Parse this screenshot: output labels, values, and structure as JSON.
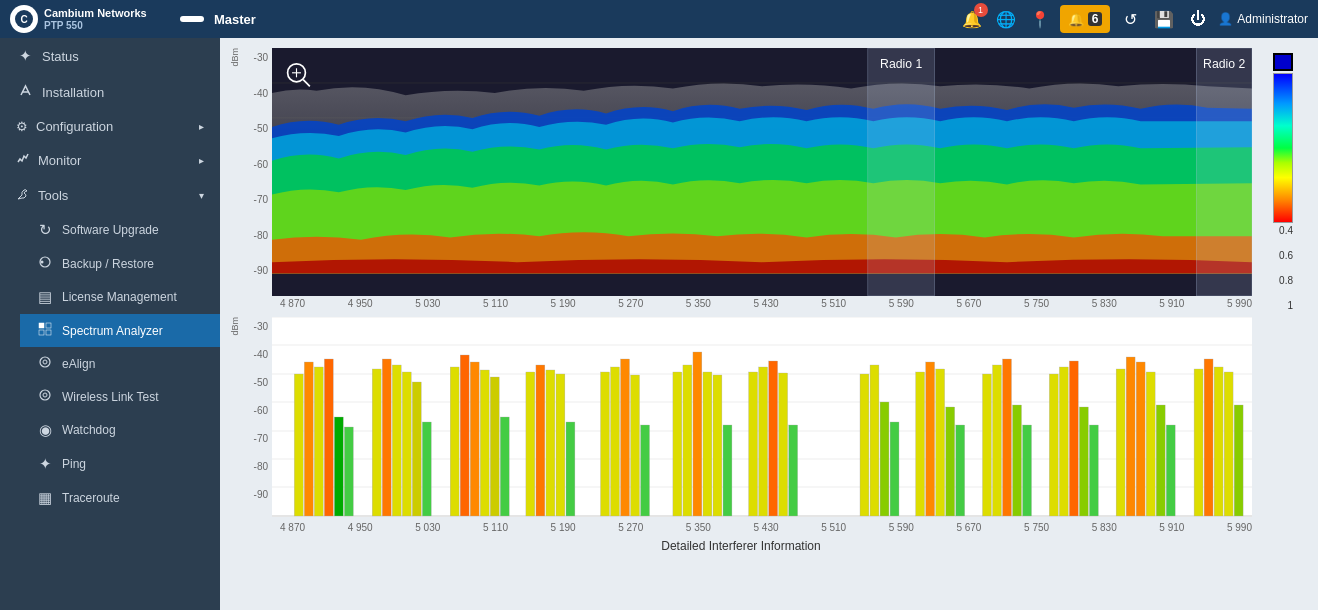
{
  "header": {
    "brand": "Cambium Networks",
    "model": "PTP 550",
    "device_name": "",
    "role": "Master",
    "alarm_label": "Alarms",
    "alarm_count": "6",
    "notification_count": "1",
    "user": "Administrator"
  },
  "sidebar": {
    "items": [
      {
        "id": "status",
        "label": "Status",
        "icon": "✦",
        "active": false
      },
      {
        "id": "installation",
        "label": "Installation",
        "icon": "⚙",
        "active": false
      },
      {
        "id": "configuration",
        "label": "Configuration",
        "icon": "⚙",
        "active": false,
        "has_arrow": true
      },
      {
        "id": "monitor",
        "label": "Monitor",
        "icon": "📊",
        "active": false,
        "has_arrow": true
      },
      {
        "id": "tools",
        "label": "Tools",
        "icon": "🔧",
        "active": false,
        "has_arrow": true
      },
      {
        "id": "software-upgrade",
        "label": "Software Upgrade",
        "icon": "↻",
        "active": false,
        "sub": true
      },
      {
        "id": "backup-restore",
        "label": "Backup / Restore",
        "icon": "⚙",
        "active": false,
        "sub": true
      },
      {
        "id": "license-management",
        "label": "License Management",
        "icon": "▤",
        "active": false,
        "sub": true
      },
      {
        "id": "spectrum-analyzer",
        "label": "Spectrum Analyzer",
        "icon": "▦",
        "active": true,
        "sub": true
      },
      {
        "id": "ealign",
        "label": "eAlign",
        "icon": "◎",
        "active": false,
        "sub": true
      },
      {
        "id": "wireless-link-test",
        "label": "Wireless Link Test",
        "icon": "◎",
        "active": false,
        "sub": true
      },
      {
        "id": "watchdog",
        "label": "Watchdog",
        "icon": "◉",
        "active": false,
        "sub": true
      },
      {
        "id": "ping",
        "label": "Ping",
        "icon": "✦",
        "active": false,
        "sub": true
      },
      {
        "id": "traceroute",
        "label": "Traceroute",
        "icon": "▦",
        "active": false,
        "sub": true
      }
    ]
  },
  "spectrum": {
    "title": "Spectrum Analyzer",
    "radio1_label": "Radio 1",
    "radio2_label": "Radio 2",
    "y_axis_heatmap": [
      "-30",
      "-40",
      "-50",
      "-60",
      "-70",
      "-80",
      "-90"
    ],
    "y_axis_bar": [
      "-30",
      "-40",
      "-50",
      "-60",
      "-70",
      "-80",
      "-90"
    ],
    "x_axis": [
      "4 870",
      "4 950",
      "5 030",
      "5 110",
      "5 190",
      "5 270",
      "5 350",
      "5 430",
      "5 510",
      "5 590",
      "5 670",
      "5 750",
      "5 830",
      "5 910",
      "5 990"
    ],
    "dbm_label": "dBm",
    "interferer_label": "Detailed Interferer Information",
    "legend_values": [
      "0.4",
      "0.6",
      "0.8",
      "1"
    ]
  }
}
